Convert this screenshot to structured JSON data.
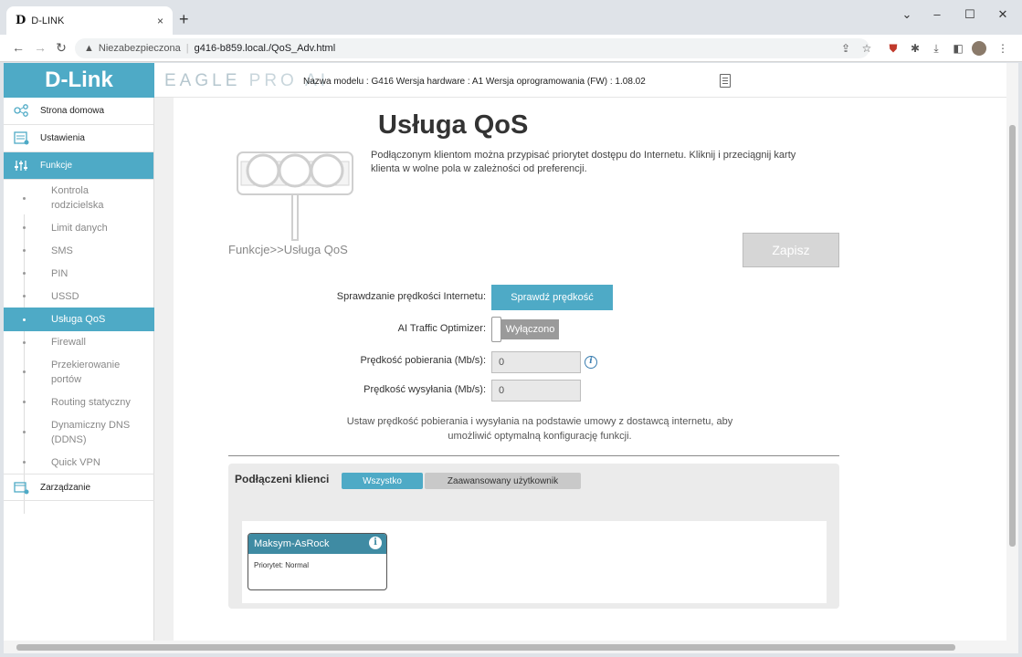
{
  "browser": {
    "tab_favicon": "D",
    "tab_title": "D-LINK",
    "tab_close": "×",
    "new_tab": "+",
    "security_text": "Niezabezpieczona",
    "url": "g416-b859.local./QoS_Adv.html"
  },
  "header": {
    "logo": "D-Link",
    "brand_prefix": "EAGLE",
    "brand_suffix": "PRO AI",
    "model_info": "Nazwa modelu : G416 Wersja hardware : A1 Wersja oprogramowania (FW) : 1.08.02"
  },
  "sidebar": {
    "main": [
      {
        "label": "Strona domowa",
        "icon": "network-icon"
      },
      {
        "label": "Ustawienia",
        "icon": "settings-icon"
      },
      {
        "label": "Funkcje",
        "icon": "features-icon"
      },
      {
        "label": "Zarządzanie",
        "icon": "management-icon"
      }
    ],
    "sub": [
      {
        "label": "Kontrola rodzicielska"
      },
      {
        "label": "Limit danych"
      },
      {
        "label": "SMS"
      },
      {
        "label": "PIN"
      },
      {
        "label": "USSD"
      },
      {
        "label": "Usługa QoS"
      },
      {
        "label": "Firewall"
      },
      {
        "label": "Przekierowanie portów"
      },
      {
        "label": "Routing statyczny"
      },
      {
        "label": "Dynamiczny DNS (DDNS)"
      },
      {
        "label": "Quick VPN"
      }
    ]
  },
  "page": {
    "title": "Usługa QoS",
    "description": "Podłączonym klientom można przypisać priorytet dostępu do Internetu. Kliknij i przeciągnij karty klienta w wolne pola w zależności od preferencji.",
    "breadcrumb": "Funkcje>>Usługa QoS",
    "save_label": "Zapisz"
  },
  "form": {
    "speed_test_label": "Sprawdzanie prędkości Internetu:",
    "speed_test_button": "Sprawdź prędkość",
    "ai_label": "AI Traffic Optimizer:",
    "ai_state": "Wyłączono",
    "download_label": "Prędkość pobierania (Mb/s):",
    "download_value": "0",
    "upload_label": "Prędkość wysyłania (Mb/s):",
    "upload_value": "0",
    "info_glyph": "i",
    "hint": "Ustaw prędkość pobierania i wysyłania na podstawie umowy z dostawcą internetu, aby umożliwić optymalną konfigurację funkcji."
  },
  "clients": {
    "title": "Podłączeni klienci",
    "tab_all": "Wszystko",
    "tab_advanced": "Zaawansowany użytkownik",
    "items": [
      {
        "name": "Maksym-AsRock",
        "priority": "Priorytet: Normal"
      }
    ]
  }
}
